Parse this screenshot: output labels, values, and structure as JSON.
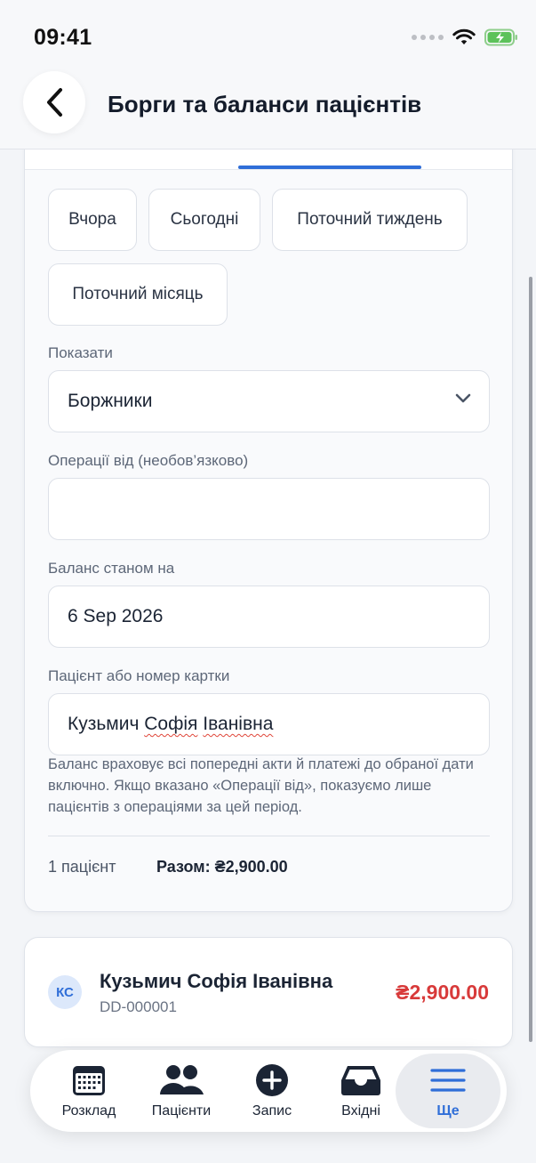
{
  "status_bar": {
    "time": "09:41"
  },
  "header": {
    "title": "Борги та баланси пацієнтів"
  },
  "filters": {
    "chips": [
      "Вчора",
      "Сьогодні",
      "Поточний тиждень",
      "Поточний місяць"
    ],
    "show": {
      "label": "Показати",
      "value": "Боржники"
    },
    "operations_from": {
      "label": "Операції від (необов’язково)",
      "value": ""
    },
    "balance_as_of": {
      "label": "Баланс станом на",
      "value": "6 Sep 2026"
    },
    "patient": {
      "label": "Пацієнт або номер картки",
      "value_part1": "Кузьмич ",
      "value_part2": "Софія",
      "value_part3": " ",
      "value_part4": "Іванівна"
    },
    "hint": "Баланс враховує всі попередні акти й платежі до обраної дати включно. Якщо вказано «Операції від», показуємо лише пацієнтів з операціями за цей період.",
    "summary": {
      "count": "1 пацієнт",
      "total": "Разом: ₴2,900.00"
    }
  },
  "patients": [
    {
      "initials": "КС",
      "name": "Кузьмич Софія Іванівна",
      "card": "DD-000001",
      "balance": "₴2,900.00"
    }
  ],
  "bottom_nav": {
    "items": [
      {
        "label": "Розклад",
        "icon": "calendar-icon"
      },
      {
        "label": "Пацієнти",
        "icon": "people-icon"
      },
      {
        "label": "Запис",
        "icon": "plus-circle-icon"
      },
      {
        "label": "Вхідні",
        "icon": "inbox-icon"
      },
      {
        "label": "Ще",
        "icon": "menu-icon"
      }
    ],
    "active": "Ще"
  },
  "colors": {
    "accent": "#2f6ed8",
    "debt": "#d83a3a"
  }
}
